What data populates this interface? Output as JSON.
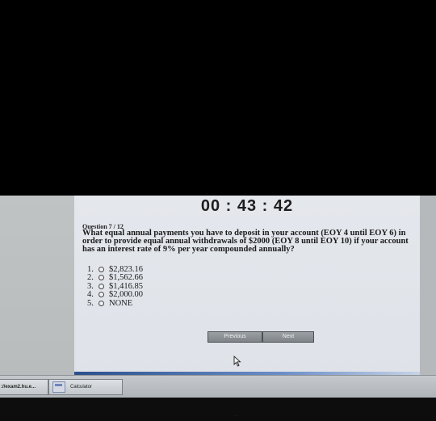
{
  "timer": "00 : 43 : 42",
  "question": {
    "number_label": "Question 7 / 12",
    "text": "What equal annual payments you have to deposit in your account (EOY 4 until EOY 6) in order to provide equal annual withdrawals of $2000 (EOY 8 until EOY 10) if your account has an interest rate of 9% per year compounded annually?"
  },
  "answers": [
    {
      "num": "1.",
      "value": "$2,823.16"
    },
    {
      "num": "2.",
      "value": "$1,562.66"
    },
    {
      "num": "3.",
      "value": "$1,416.85"
    },
    {
      "num": "4.",
      "value": "$2,000.00"
    },
    {
      "num": "5.",
      "value": "NONE"
    }
  ],
  "buttons": {
    "previous": "Previous",
    "next": "Next"
  },
  "taskbar": {
    "exam_task": "://exam2.hu.e...",
    "calculator_task": "Calculator"
  },
  "bottom_label": "..."
}
